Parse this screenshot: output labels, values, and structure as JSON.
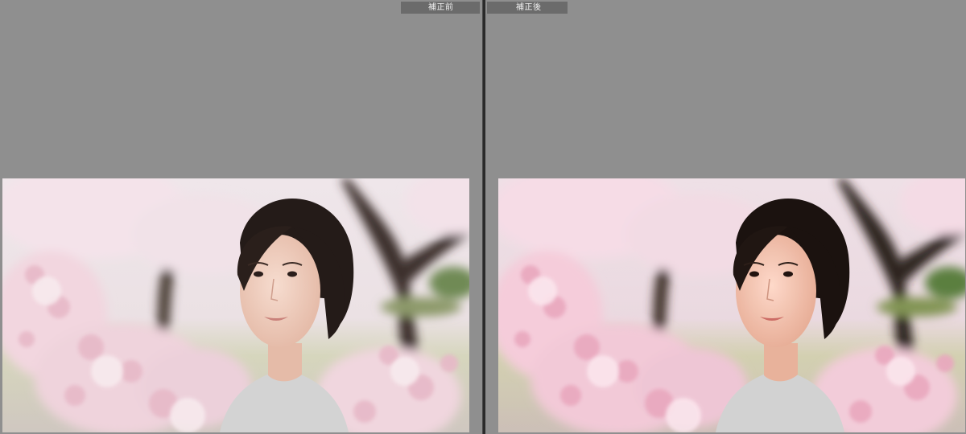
{
  "comparison": {
    "before_label": "補正前",
    "after_label": "補正後"
  },
  "photo": {
    "subject": "portrait-woman-cherry-blossoms",
    "palette": {
      "sky": "#efe6ea",
      "blossom": "#f3dbe3",
      "blossom_deep": "#e7b9c8",
      "trunk": "#3b2f2a",
      "ground": "#c7c3a6",
      "hair": "#241b18",
      "skin": "#efd0c2",
      "shirt": "#c9c9c9"
    }
  },
  "colors": {
    "background": "#8e8e8e",
    "tab": "#6b6b6b",
    "divider": "#2a2a2a"
  }
}
